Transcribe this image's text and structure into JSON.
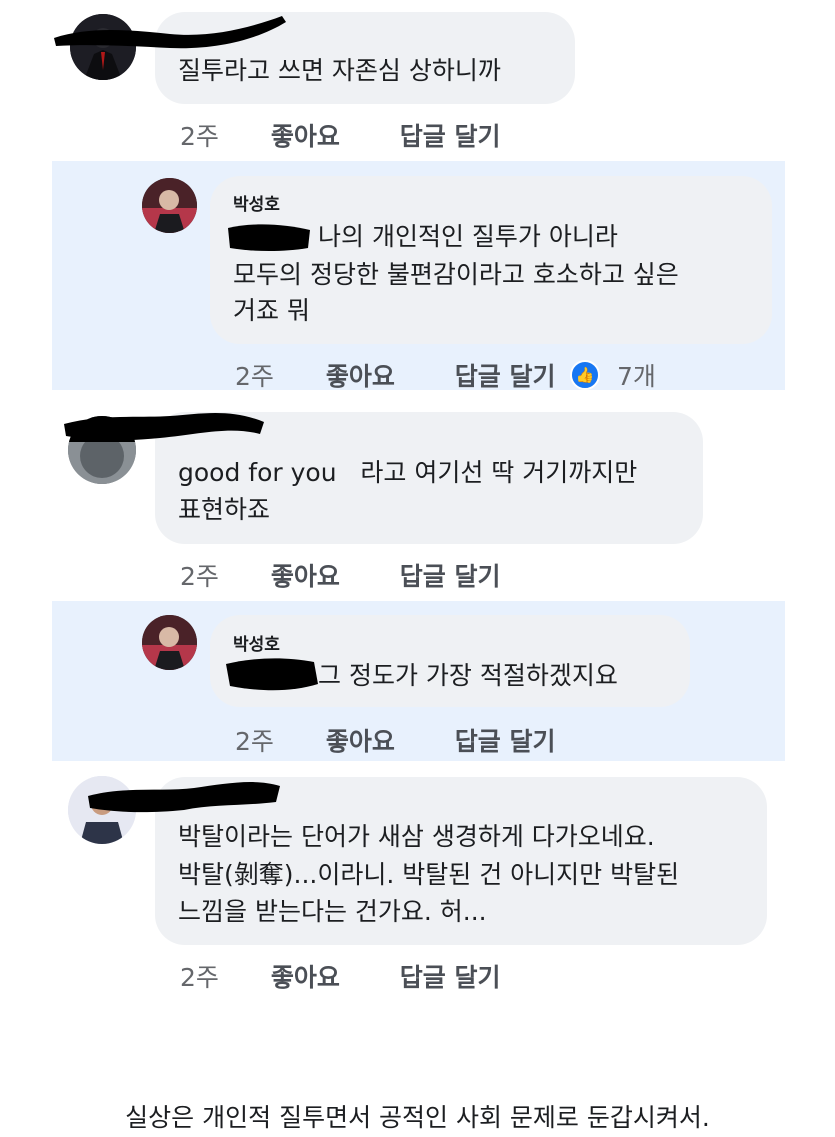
{
  "comments": [
    {
      "author": "",
      "lines": [
        "질투라고 쓰면 자존심 상하니까"
      ],
      "time": "2주",
      "like": "좋아요",
      "reply": "답글 달기"
    },
    {
      "author": "박성호",
      "lines": [
        "나의 개인적인 질투가 아니라",
        "모두의 정당한 불편감이라고 호소하고 싶은",
        "거죠 뭐"
      ],
      "time": "2주",
      "like": "좋아요",
      "reply": "답글 달기",
      "reaction_icon": "thumbs-up-icon",
      "reaction_count": "7개"
    },
    {
      "author": "",
      "lines": [
        "good for you   라고 여기선 딱 거기까지만",
        "표현하죠"
      ],
      "time": "2주",
      "like": "좋아요",
      "reply": "답글 달기"
    },
    {
      "author": "박성호",
      "lines": [
        "그 정도가 가장 적절하겠지요"
      ],
      "time": "2주",
      "like": "좋아요",
      "reply": "답글 달기"
    },
    {
      "author": "",
      "lines": [
        "박탈이라는 단어가 새삼 생경하게 다가오네요.",
        "박탈(剝奪)...이라니. 박탈된 건 아니지만 박탈된",
        "느낌을 받는다는 건가요. 허..."
      ],
      "time": "2주",
      "like": "좋아요",
      "reply": "답글 달기"
    }
  ],
  "caption": "실상은 개인적 질투면서 공적인 사회 문제로 둔갑시켜서.",
  "colors": {
    "highlight": "#e8f1fd",
    "bubble": "#eff1f4",
    "like_blue": "#1877f2"
  }
}
